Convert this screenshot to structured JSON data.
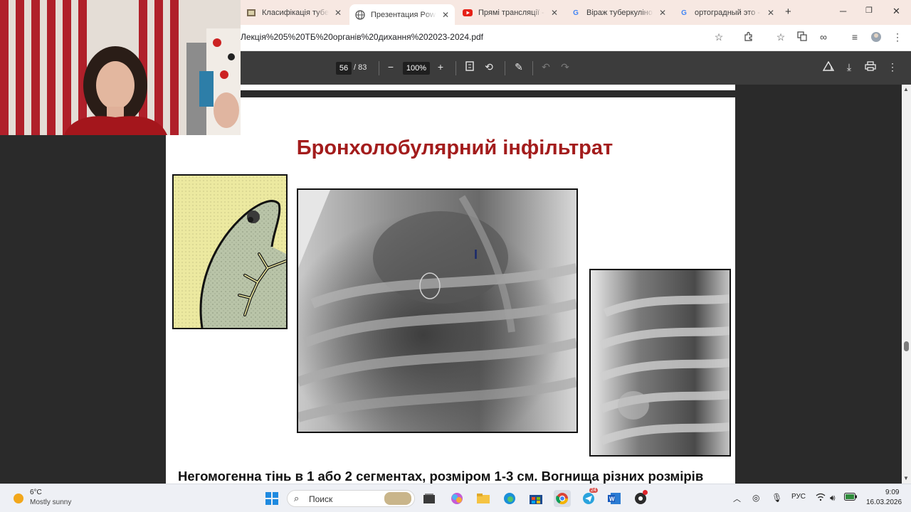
{
  "browser": {
    "tabs": [
      {
        "label": "Класифікація туберк",
        "favicon": "slides-icon",
        "active": false
      },
      {
        "label": "Презентация PowerP",
        "favicon": "globe-icon",
        "active": true
      },
      {
        "label": "Прямі трансляції - Y",
        "favicon": "youtube-icon",
        "active": false
      },
      {
        "label": "Віраж туберкуліново",
        "favicon": "google-icon",
        "active": false
      },
      {
        "label": "ортоградный это - П",
        "favicon": "google-icon",
        "active": false
      }
    ],
    "new_tab": "+",
    "url": "Лекція%205%20ТБ%20органів%20дихання%202023-2024.pdf"
  },
  "pdf_toolbar": {
    "current_page": "56",
    "total_pages": "/ 83",
    "zoom": "100%",
    "zoom_out": "−",
    "zoom_in": "+"
  },
  "slide": {
    "title": "Бронхолобулярний інфільтрат",
    "caption": "Негомогенна тінь в 1 або 2 сегментах, розміром  1-3 см. Вогнища різних розмірів зливаються в один або кілька конгломератів."
  },
  "taskbar": {
    "weather_temp": "6°C",
    "weather_desc": "Mostly sunny",
    "search_label": "Поиск",
    "language": "РУС",
    "time": "9:09",
    "date": "16.03.2026",
    "telegram_badge": "24"
  },
  "colors": {
    "title_red": "#a31c1c",
    "tab_strip": "#f7e8e2",
    "pdf_toolbar": "#3c3c3c",
    "viewer_bg": "#2a2a2a"
  }
}
